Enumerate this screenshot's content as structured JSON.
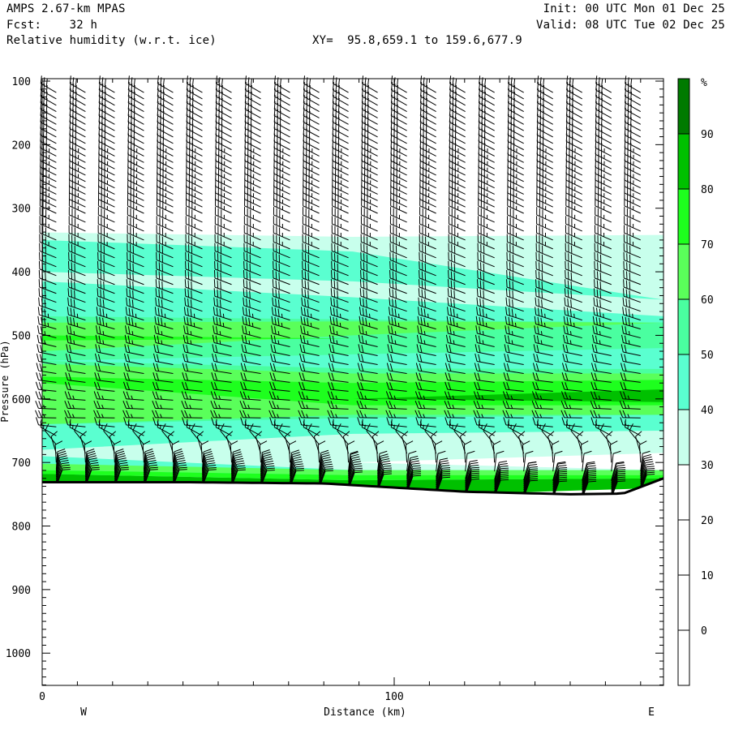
{
  "header": {
    "model": "AMPS 2.67-km MPAS",
    "forecast": "Fcst:    32 h",
    "field": "Relative humidity (w.r.t. ice)",
    "xy_range": "XY=  95.8,659.1 to 159.6,677.9",
    "init": "Init: 00 UTC Mon 01 Dec 25",
    "valid": "Valid: 08 UTC Tue 02 Dec 25"
  },
  "chart_data": {
    "type": "cross-section",
    "title": "Relative humidity (w.r.t. ice)",
    "xlabel": "Distance (km)",
    "ylabel": "Pressure (hPa)",
    "xlim": [
      0,
      176.5
    ],
    "ylim": [
      1050,
      96
    ],
    "x_ticks": [
      0,
      100
    ],
    "y_ticks": [
      100,
      200,
      300,
      400,
      500,
      600,
      700,
      800,
      900,
      1000
    ],
    "x_end_labels": {
      "left": "W",
      "right": "E"
    },
    "colorbar": {
      "unit": "%",
      "tick_labels": [
        "90",
        "80",
        "70",
        "60",
        "50",
        "40",
        "30",
        "20",
        "10",
        "0"
      ],
      "levels": [
        {
          "min": 90,
          "color": "#007a00"
        },
        {
          "min": 80,
          "color": "#00c000"
        },
        {
          "min": 70,
          "color": "#1eff1e"
        },
        {
          "min": 60,
          "color": "#5aff5a"
        },
        {
          "min": 50,
          "color": "#4affa0"
        },
        {
          "min": 40,
          "color": "#5affd0"
        },
        {
          "min": 30,
          "color": "#c8ffec"
        },
        {
          "min": 20,
          "color": "#ffffff"
        },
        {
          "min": 10,
          "color": "#ffffff"
        },
        {
          "min": 0,
          "color": "#ffffff"
        },
        {
          "min": -10,
          "color": "#ffffff"
        }
      ]
    },
    "band_nodes_km": [
      0,
      88,
      176.5
    ],
    "rh_bands": [
      {
        "rh": 30,
        "top": [
          338,
          345,
          342
        ],
        "bottom": [
          735,
          750,
          735
        ]
      },
      {
        "rh": 40,
        "top": [
          350,
          368,
          444
        ],
        "bottom": [
          400,
          415,
          444
        ]
      },
      {
        "rh": 40,
        "top": [
          415,
          440,
          470
        ],
        "bottom": [
          720,
          720,
          720
        ]
      },
      {
        "rh": 50,
        "top": [
          470,
          475,
          480
        ],
        "bottom": [
          650,
          630,
          640
        ]
      },
      {
        "rh": 40,
        "top": [
          540,
          530,
          520
        ],
        "bottom": [
          540,
          552,
          553
        ]
      },
      {
        "rh": 60,
        "top": [
          480,
          478,
          480
        ],
        "bottom": [
          525,
          500,
          480
        ]
      },
      {
        "rh": 70,
        "top": [
          500,
          505,
          505
        ],
        "bottom": [
          508,
          505,
          505
        ]
      },
      {
        "rh": 60,
        "top": [
          545,
          560,
          560
        ],
        "bottom": [
          640,
          625,
          625
        ]
      },
      {
        "rh": 70,
        "top": [
          565,
          575,
          570
        ],
        "bottom": [
          575,
          610,
          610
        ]
      },
      {
        "rh": 80,
        "top": [
          600,
          600,
          585
        ],
        "bottom": [
          600,
          600,
          605
        ]
      },
      {
        "rh": 40,
        "top": [
          640,
          630,
          625
        ],
        "bottom": [
          710,
          715,
          715
        ]
      },
      {
        "rh": 30,
        "top": [
          680,
          655,
          650
        ],
        "bottom": [
          690,
          712,
          712
        ]
      },
      {
        "rh": 20,
        "top": [
          700,
          700,
          685
        ],
        "bottom": [
          700,
          700,
          712
        ]
      },
      {
        "rh": 60,
        "top": [
          702,
          712,
          712
        ],
        "bottom": [
          712,
          720,
          722
        ]
      },
      {
        "rh": 70,
        "top": [
          712,
          720,
          720
        ],
        "bottom": [
          718,
          728,
          725
        ]
      },
      {
        "rh": 80,
        "top": [
          718,
          728,
          725
        ],
        "bottom": [
          740,
          755,
          740
        ]
      }
    ],
    "surface_pressure": {
      "km": [
        0,
        40,
        80,
        120,
        150,
        165,
        176.5
      ],
      "hPa": [
        731,
        731,
        733,
        746,
        750,
        749,
        725
      ]
    },
    "wind_barbs": {
      "columns_start_km": 4,
      "columns_step_km": 8.3,
      "columns_count": 21,
      "level_step_hPa": 14,
      "profile": [
        {
          "p": 120,
          "dir": 300,
          "kt": 30
        },
        {
          "p": 300,
          "dir": 295,
          "kt": 35
        },
        {
          "p": 450,
          "dir": 290,
          "kt": 30
        },
        {
          "p": 550,
          "dir": 280,
          "kt": 20
        },
        {
          "p": 640,
          "dir": 270,
          "kt": 15
        },
        {
          "p": 690,
          "dir": 350,
          "kt": 10
        },
        {
          "p": 735,
          "dir": 20,
          "kt": 10
        }
      ]
    }
  }
}
